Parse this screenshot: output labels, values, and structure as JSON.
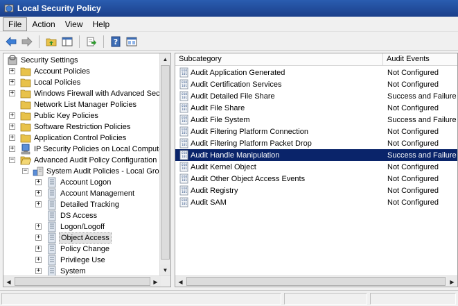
{
  "window": {
    "title": "Local Security Policy"
  },
  "menu": [
    "File",
    "Action",
    "View",
    "Help"
  ],
  "toolbar": [
    "back-icon",
    "forward-icon",
    "up-folder-icon",
    "show-hide-tree-icon",
    "export-list-icon",
    "help-icon",
    "properties-icon"
  ],
  "tree": {
    "root": "Security Settings",
    "items": [
      "Account Policies",
      "Local Policies",
      "Windows Firewall with Advanced Security",
      "Network List Manager Policies",
      "Public Key Policies",
      "Software Restriction Policies",
      "Application Control Policies",
      "IP Security Policies on Local Computer",
      "Advanced Audit Policy Configuration"
    ],
    "system_audit": "System Audit Policies - Local Group Policy Object",
    "categories": [
      "Account Logon",
      "Account Management",
      "Detailed Tracking",
      "DS Access",
      "Logon/Logoff",
      "Object Access",
      "Policy Change",
      "Privilege Use",
      "System"
    ],
    "selected": "Object Access"
  },
  "list": {
    "columns": [
      "Subcategory",
      "Audit Events"
    ],
    "rows": [
      {
        "subcategory": "Audit Application Generated",
        "events": "Not Configured"
      },
      {
        "subcategory": "Audit Certification Services",
        "events": "Not Configured"
      },
      {
        "subcategory": "Audit Detailed File Share",
        "events": "Success and Failure"
      },
      {
        "subcategory": "Audit File Share",
        "events": "Not Configured"
      },
      {
        "subcategory": "Audit File System",
        "events": "Success and Failure"
      },
      {
        "subcategory": "Audit Filtering Platform Connection",
        "events": "Not Configured"
      },
      {
        "subcategory": "Audit Filtering Platform Packet Drop",
        "events": "Not Configured"
      },
      {
        "subcategory": "Audit Handle Manipulation",
        "events": "Success and Failure"
      },
      {
        "subcategory": "Audit Kernel Object",
        "events": "Not Configured"
      },
      {
        "subcategory": "Audit Other Object Access Events",
        "events": "Not Configured"
      },
      {
        "subcategory": "Audit Registry",
        "events": "Not Configured"
      },
      {
        "subcategory": "Audit SAM",
        "events": "Not Configured"
      }
    ],
    "selected": "Audit Handle Manipulation"
  },
  "colors": {
    "titlebar": "#1f4a9c",
    "selection": "#0a246a",
    "folder": "#e8c24a"
  }
}
